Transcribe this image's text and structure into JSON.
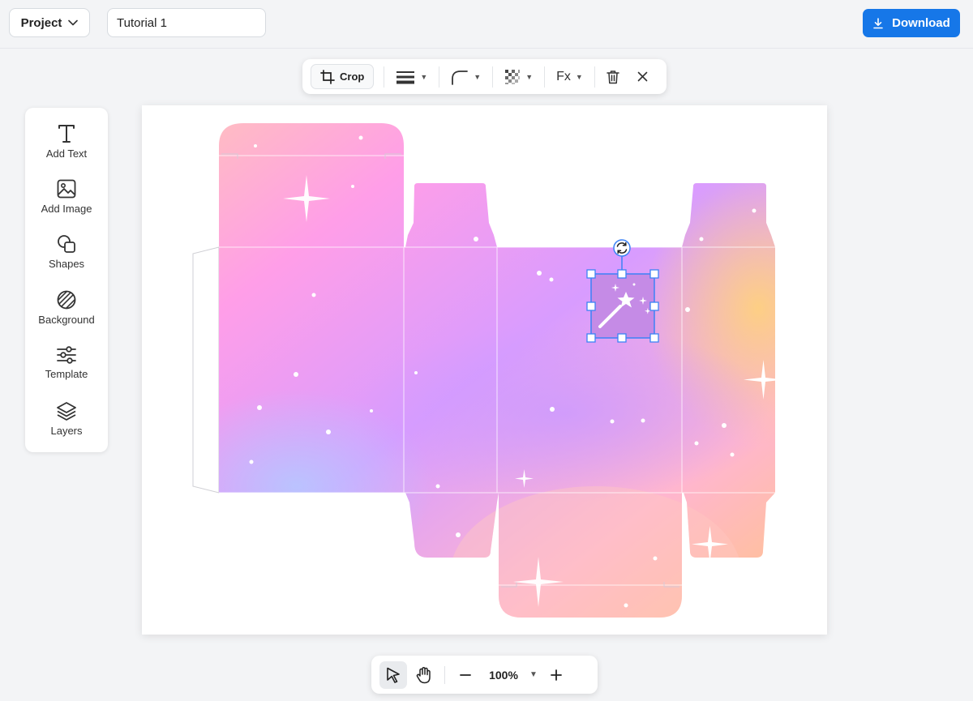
{
  "topbar": {
    "project_label": "Project",
    "title_value": "Tutorial 1",
    "download_label": "Download"
  },
  "context_toolbar": {
    "crop_label": "Crop",
    "fx_label": "Fx"
  },
  "tools": [
    {
      "label": "Add Text",
      "icon": "text-icon"
    },
    {
      "label": "Add Image",
      "icon": "image-icon"
    },
    {
      "label": "Shapes",
      "icon": "shapes-icon"
    },
    {
      "label": "Background",
      "icon": "background-icon"
    },
    {
      "label": "Template",
      "icon": "sliders-icon"
    },
    {
      "label": "Layers",
      "icon": "layers-icon"
    }
  ],
  "zoom": {
    "level": "100%"
  },
  "colors": {
    "accent": "#1677e8",
    "selection": "#3b82f6",
    "selected_element_fill": "#c58be6"
  }
}
